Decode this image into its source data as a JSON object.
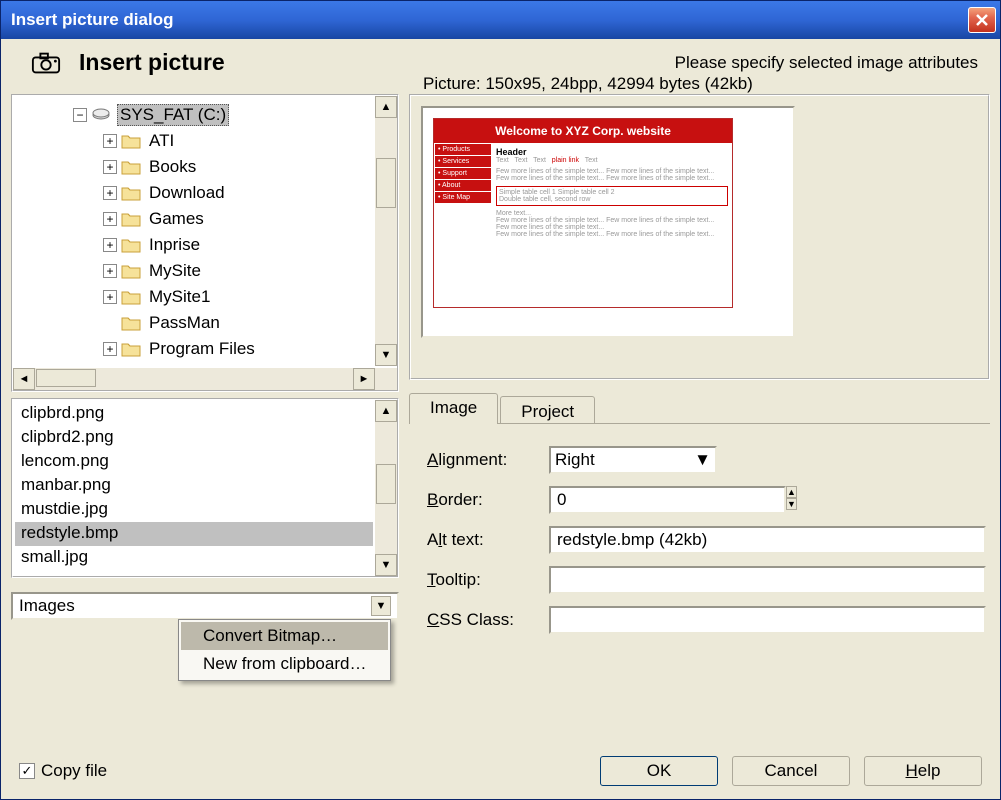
{
  "window": {
    "title": "Insert picture dialog"
  },
  "header": {
    "title": "Insert picture",
    "right": "Please specify selected image attributes"
  },
  "tree": {
    "root": {
      "label": "SYS_FAT (C:)",
      "selected": true
    },
    "folders": [
      "ATI",
      "Books",
      "Download",
      "Games",
      "Inprise",
      "MySite",
      "MySite1",
      "PassMan",
      "Program Files"
    ]
  },
  "files": [
    "clipbrd.png",
    "clipbrd2.png",
    "lencom.png",
    "manbar.png",
    "mustdie.jpg",
    "redstyle.bmp",
    "small.jpg"
  ],
  "selected_file_index": 5,
  "type_filter": "Images",
  "preview": {
    "legend": "Picture: 150x95, 24bpp, 42994 bytes (42kb)",
    "banner": "Welcome to XYZ Corp. website"
  },
  "tabs": {
    "image": "Image",
    "project": "Project"
  },
  "form": {
    "alignment_label": "Alignment:",
    "alignment_value": "Right",
    "border_label": "Border:",
    "border_value": "0",
    "alt_label": "Alt text:",
    "alt_value": "redstyle.bmp (42kb)",
    "tooltip_label": "Tooltip:",
    "tooltip_value": "",
    "css_label": "CSS Class:",
    "css_value": ""
  },
  "context_menu": {
    "item1": "Convert Bitmap…",
    "item2": "New from clipboard…"
  },
  "footer": {
    "copy": "Copy file",
    "ok": "OK",
    "cancel": "Cancel",
    "help": "Help"
  }
}
